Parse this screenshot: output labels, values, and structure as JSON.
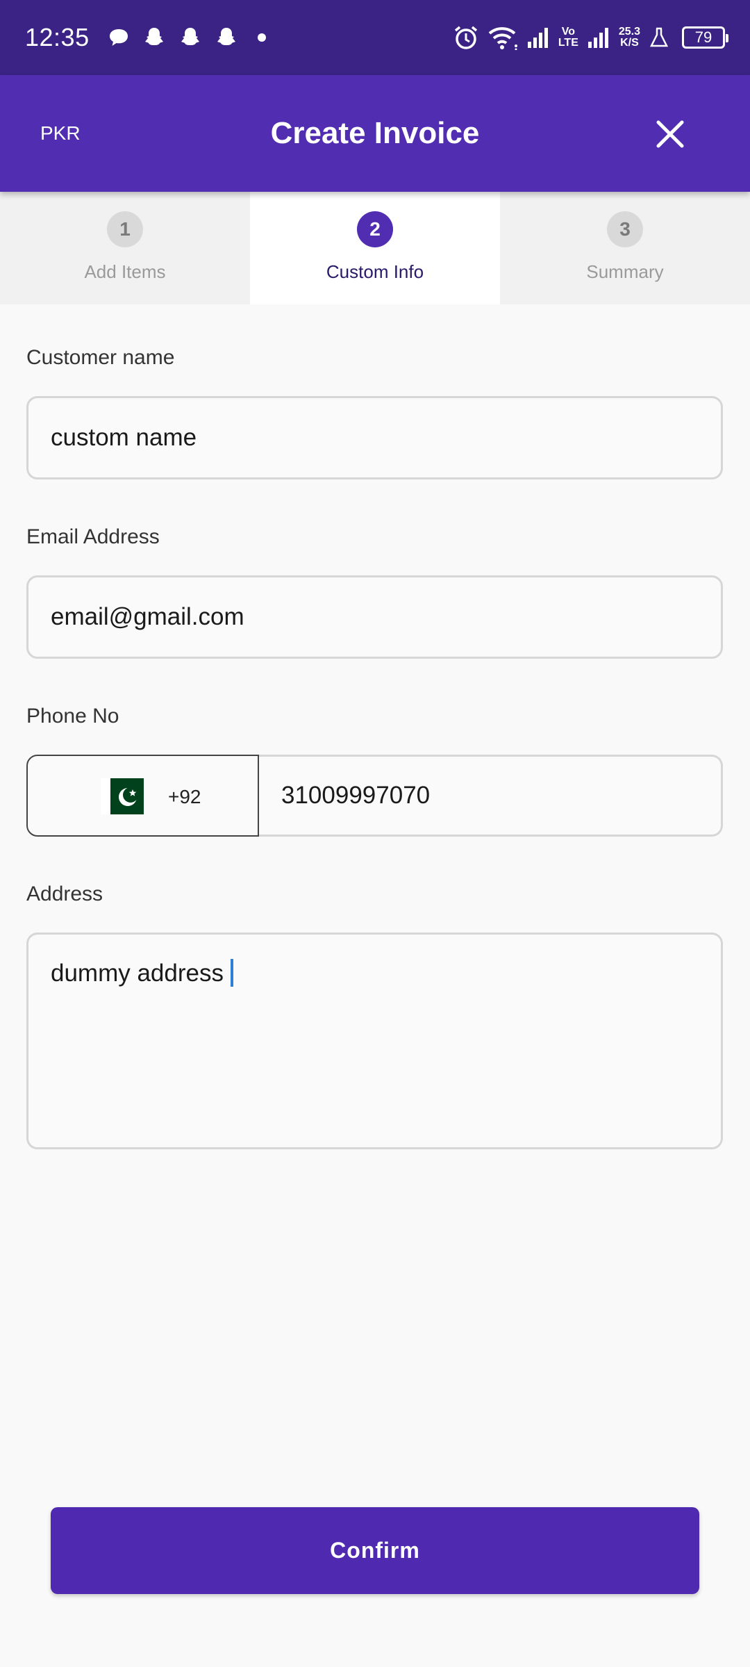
{
  "status_bar": {
    "time": "12:35",
    "network_speed_value": "25.3",
    "network_speed_unit": "K/S",
    "volte_top": "Vo",
    "volte_bottom": "LTE",
    "battery": "79",
    "icons": [
      "message-icon",
      "snapchat-icon",
      "snapchat-icon",
      "snapchat-icon",
      "dot-icon",
      "alarm-icon",
      "wifi-icon",
      "signal-icon",
      "signal-icon",
      "lab-icon",
      "battery-icon"
    ]
  },
  "app_bar": {
    "currency": "PKR",
    "title": "Create Invoice",
    "close_icon": "close-icon"
  },
  "stepper": {
    "steps": [
      {
        "number": "1",
        "label": "Add Items",
        "active": false
      },
      {
        "number": "2",
        "label": "Custom Info",
        "active": true
      },
      {
        "number": "3",
        "label": "Summary",
        "active": false
      }
    ]
  },
  "form": {
    "customer_name": {
      "label": "Customer name",
      "value": "custom name"
    },
    "email": {
      "label": "Email Address",
      "value": "email@gmail.com"
    },
    "phone": {
      "label": "Phone No",
      "country_flag": "pakistan-flag-icon",
      "dial_code": "+92",
      "value": "31009997070"
    },
    "address": {
      "label": "Address",
      "value": "dummy address"
    }
  },
  "actions": {
    "confirm_label": "Confirm"
  },
  "colors": {
    "status_bar": "#3a2384",
    "primary": "#512db1",
    "button": "#4f2ab0",
    "caret": "#2f7fd6"
  }
}
